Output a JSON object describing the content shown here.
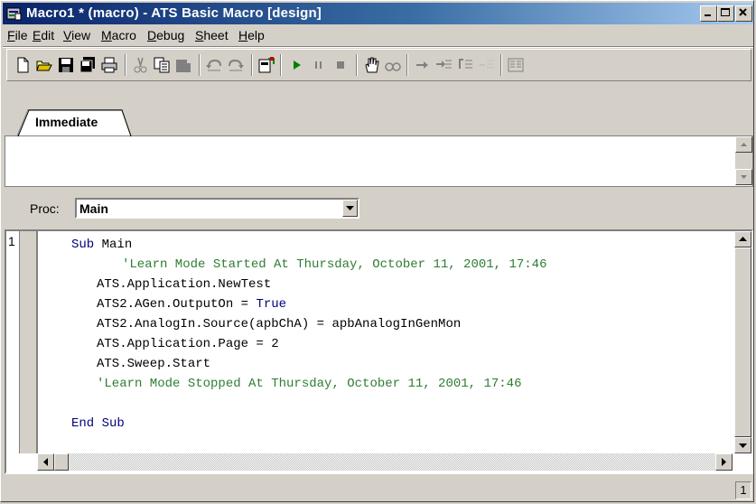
{
  "window": {
    "title": "Macro1 * (macro) - ATS Basic Macro [design]"
  },
  "menu": {
    "items": [
      {
        "label": "File",
        "mnemonic": "F",
        "rest": "ile"
      },
      {
        "label": "Edit",
        "mnemonic": "E",
        "rest": "dit"
      },
      {
        "label": "View",
        "mnemonic": "V",
        "rest": "iew"
      },
      {
        "label": "Macro",
        "mnemonic": "M",
        "rest": "acro"
      },
      {
        "label": "Debug",
        "mnemonic": "D",
        "rest": "ebug"
      },
      {
        "label": "Sheet",
        "mnemonic": "S",
        "rest": "heet"
      },
      {
        "label": "Help",
        "mnemonic": "H",
        "rest": "elp"
      }
    ]
  },
  "toolbar": {
    "icons": [
      "new-icon",
      "open-icon",
      "save-icon",
      "save-all-icon",
      "print-icon",
      "cut-icon",
      "copy-icon",
      "paste-icon",
      "undo-icon",
      "redo-icon",
      "dialog-editor-icon",
      "run-icon",
      "pause-icon",
      "stop-icon",
      "toggle-breakpoint-icon",
      "quick-watch-icon",
      "step-icon",
      "step-into-icon",
      "step-over-icon",
      "step-out-icon",
      "object-browser-icon"
    ]
  },
  "immediate": {
    "tab_label": "Immediate"
  },
  "proc": {
    "label": "Proc:",
    "selected": "Main"
  },
  "editor": {
    "line_number": "1",
    "lines": [
      {
        "indent": 0,
        "parts": [
          {
            "t": "Sub",
            "k": "kw"
          },
          {
            "t": " Main",
            "k": ""
          }
        ]
      },
      {
        "indent": 2,
        "parts": [
          {
            "t": "'Learn Mode Started At Thursday, October 11, 2001, 17:46",
            "k": "cm"
          }
        ]
      },
      {
        "indent": 1,
        "parts": [
          {
            "t": "ATS.Application.NewTest",
            "k": ""
          }
        ]
      },
      {
        "indent": 1,
        "parts": [
          {
            "t": "ATS2.AGen.OutputOn = ",
            "k": ""
          },
          {
            "t": "True",
            "k": "kw"
          }
        ]
      },
      {
        "indent": 1,
        "parts": [
          {
            "t": "ATS2.AnalogIn.Source(apbChA) = apbAnalogInGenMon",
            "k": ""
          }
        ]
      },
      {
        "indent": 1,
        "parts": [
          {
            "t": "ATS.Application.Page = 2",
            "k": ""
          }
        ]
      },
      {
        "indent": 1,
        "parts": [
          {
            "t": "ATS.Sweep.Start",
            "k": ""
          }
        ]
      },
      {
        "indent": 1,
        "parts": [
          {
            "t": "'Learn Mode Stopped At Thursday, October 11, 2001, 17:46",
            "k": "cm"
          }
        ]
      },
      {
        "indent": 0,
        "parts": [
          {
            "t": "",
            "k": ""
          }
        ]
      },
      {
        "indent": 0,
        "parts": [
          {
            "t": "End Sub",
            "k": "kw"
          }
        ]
      }
    ]
  },
  "status": {
    "field": "1"
  },
  "colors": {
    "keyword": "#00007f",
    "comment": "#2e7d32",
    "title_start": "#0a246a",
    "title_end": "#a6caf0"
  }
}
